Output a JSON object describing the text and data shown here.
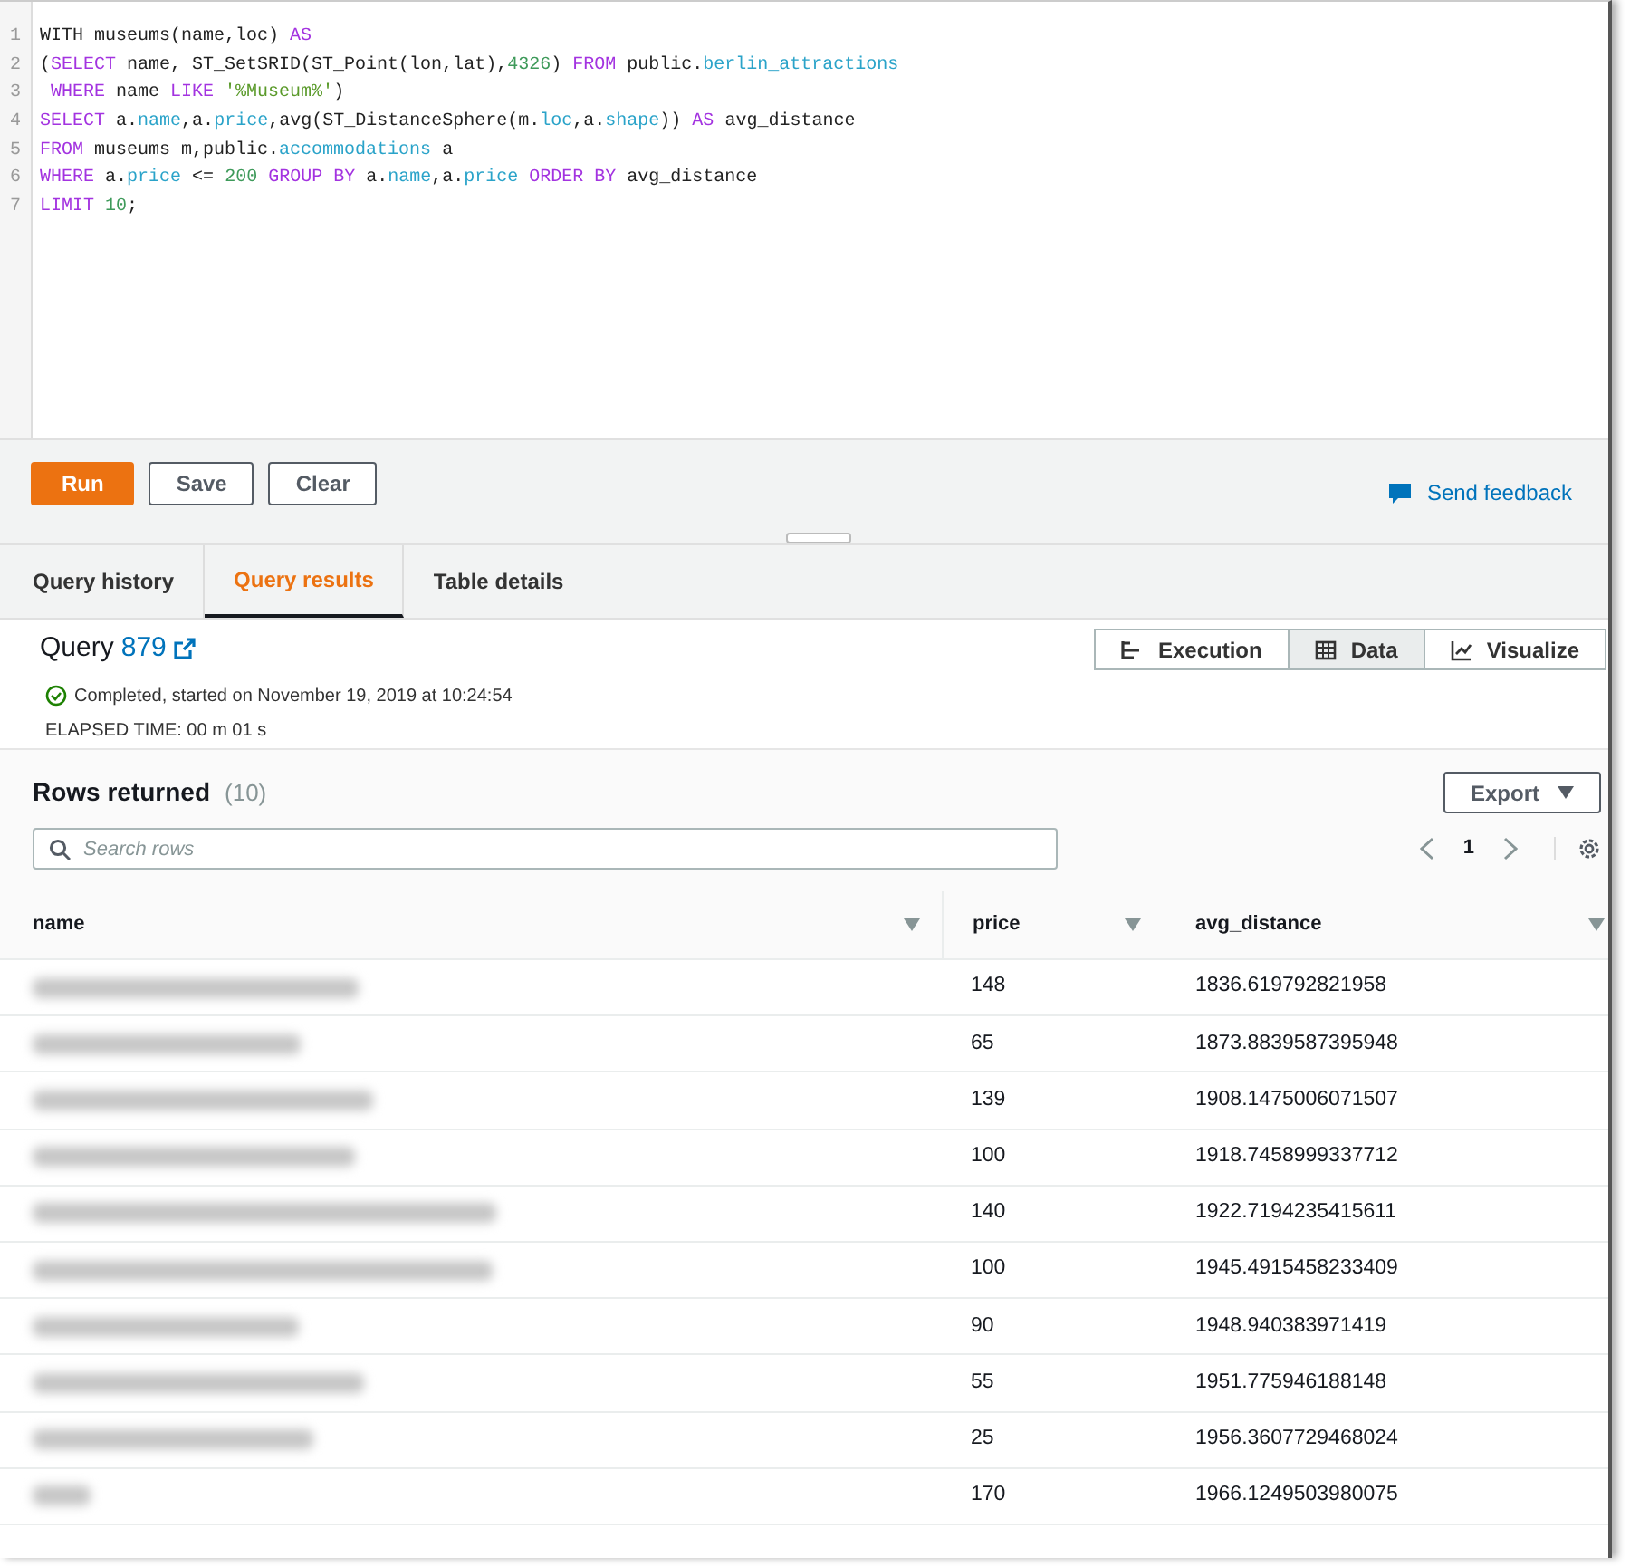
{
  "editor": {
    "lines": [
      {
        "number": "1",
        "tokens": [
          {
            "kind": "plain",
            "text": "WITH museums(name,loc) "
          },
          {
            "kind": "keyword",
            "text": "AS"
          }
        ]
      },
      {
        "number": "2",
        "tokens": [
          {
            "kind": "plain",
            "text": "("
          },
          {
            "kind": "keyword",
            "text": "SELECT"
          },
          {
            "kind": "plain",
            "text": " name, ST_SetSRID(ST_Point(lon,lat),"
          },
          {
            "kind": "number",
            "text": "4326"
          },
          {
            "kind": "plain",
            "text": ") "
          },
          {
            "kind": "keyword",
            "text": "FROM"
          },
          {
            "kind": "plain",
            "text": " public."
          },
          {
            "kind": "member",
            "text": "berlin_attractions"
          }
        ]
      },
      {
        "number": "3",
        "tokens": [
          {
            "kind": "keyword",
            "text": " WHERE"
          },
          {
            "kind": "plain",
            "text": " name "
          },
          {
            "kind": "keyword",
            "text": "LIKE"
          },
          {
            "kind": "string",
            "text": " '%Museum%'"
          },
          {
            "kind": "plain",
            "text": ")"
          }
        ]
      },
      {
        "number": "4",
        "tokens": [
          {
            "kind": "keyword",
            "text": "SELECT"
          },
          {
            "kind": "plain",
            "text": " a."
          },
          {
            "kind": "member",
            "text": "name"
          },
          {
            "kind": "plain",
            "text": ",a."
          },
          {
            "kind": "member",
            "text": "price"
          },
          {
            "kind": "plain",
            "text": ",avg(ST_DistanceSphere(m."
          },
          {
            "kind": "member",
            "text": "loc"
          },
          {
            "kind": "plain",
            "text": ",a."
          },
          {
            "kind": "member",
            "text": "shape"
          },
          {
            "kind": "plain",
            "text": ")) "
          },
          {
            "kind": "keyword",
            "text": "AS"
          },
          {
            "kind": "plain",
            "text": " avg_distance"
          }
        ]
      },
      {
        "number": "5",
        "tokens": [
          {
            "kind": "keyword",
            "text": "FROM"
          },
          {
            "kind": "plain",
            "text": " museums m,public."
          },
          {
            "kind": "member",
            "text": "accommodations"
          },
          {
            "kind": "plain",
            "text": " a"
          }
        ]
      },
      {
        "number": "6",
        "tokens": [
          {
            "kind": "keyword",
            "text": "WHERE"
          },
          {
            "kind": "plain",
            "text": " a."
          },
          {
            "kind": "member",
            "text": "price"
          },
          {
            "kind": "plain",
            "text": " <= "
          },
          {
            "kind": "number",
            "text": "200"
          },
          {
            "kind": "keyword",
            "text": " GROUP BY"
          },
          {
            "kind": "plain",
            "text": " a."
          },
          {
            "kind": "member",
            "text": "name"
          },
          {
            "kind": "plain",
            "text": ",a."
          },
          {
            "kind": "member",
            "text": "price"
          },
          {
            "kind": "keyword",
            "text": " ORDER BY"
          },
          {
            "kind": "plain",
            "text": " avg_distance"
          }
        ]
      },
      {
        "number": "7",
        "tokens": [
          {
            "kind": "keyword",
            "text": "LIMIT"
          },
          {
            "kind": "number",
            "text": " 10"
          },
          {
            "kind": "plain",
            "text": ";"
          }
        ]
      }
    ]
  },
  "toolbar": {
    "buttons": [
      {
        "label": "Run",
        "kind": "primary"
      },
      {
        "label": "Save",
        "kind": "secondary"
      },
      {
        "label": "Clear",
        "kind": "secondary"
      }
    ],
    "feedback": "Send feedback"
  },
  "tabs": [
    {
      "label": "Query history",
      "selected": false
    },
    {
      "label": "Query results",
      "selected": true
    },
    {
      "label": "Table details",
      "selected": false
    }
  ],
  "query": {
    "label": "Query",
    "id": "879",
    "status": "Completed, started on November 19, 2019 at 10:24:54",
    "elapsed": "ELAPSED TIME: 00 m 01 s",
    "views": [
      {
        "label": "Execution",
        "kind": "execution",
        "selected": false
      },
      {
        "label": "Data",
        "kind": "data",
        "selected": true
      },
      {
        "label": "Visualize",
        "kind": "visualize",
        "selected": false
      }
    ]
  },
  "results": {
    "title": "Rows returned",
    "count": "(10)",
    "export": "Export",
    "search_placeholder": "Search rows",
    "page": "1",
    "columns": [
      "name",
      "price",
      "avg_distance"
    ],
    "rows": [
      {
        "name_redacted": true,
        "price": "148",
        "avg_distance": "1836.619792821958"
      },
      {
        "name_redacted": true,
        "price": "65",
        "avg_distance": "1873.8839587395948"
      },
      {
        "name_redacted": true,
        "price": "139",
        "avg_distance": "1908.1475006071507"
      },
      {
        "name_redacted": true,
        "price": "100",
        "avg_distance": "1918.7458999337712"
      },
      {
        "name_redacted": true,
        "price": "140",
        "avg_distance": "1922.7194235415611"
      },
      {
        "name_redacted": true,
        "price": "100",
        "avg_distance": "1945.4915458233409"
      },
      {
        "name_redacted": true,
        "price": "90",
        "avg_distance": "1948.940383971419"
      },
      {
        "name_redacted": true,
        "price": "55",
        "avg_distance": "1951.775946188148"
      },
      {
        "name_redacted": true,
        "price": "25",
        "avg_distance": "1956.3607729468024"
      },
      {
        "name_redacted": true,
        "price": "170",
        "avg_distance": "1966.1249503980075"
      }
    ]
  }
}
